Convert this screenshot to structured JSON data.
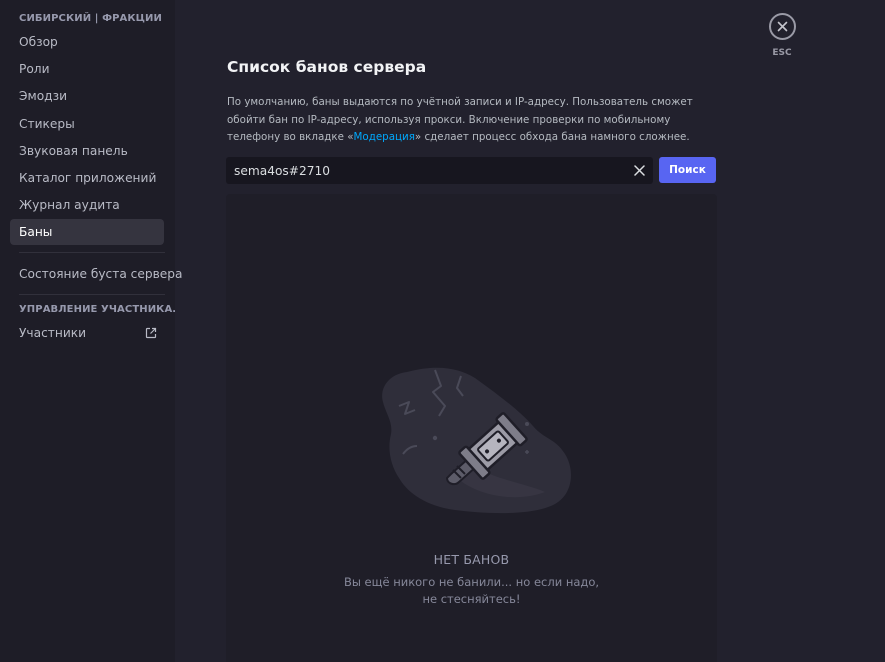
{
  "sidebar": {
    "server_header": "СИБИРСКИЙ | ФРАКЦИИ",
    "items": [
      {
        "label": "Обзор"
      },
      {
        "label": "Роли"
      },
      {
        "label": "Эмодзи"
      },
      {
        "label": "Стикеры"
      },
      {
        "label": "Звуковая панель"
      },
      {
        "label": "Каталог приложений"
      },
      {
        "label": "Журнал аудита"
      },
      {
        "label": "Баны",
        "active": true
      }
    ],
    "boost_status": "Состояние буста сервера",
    "members_header": "УПРАВЛЕНИЕ УЧАСТНИКА...",
    "members_item": "Участники",
    "members_item_icon": "external-link-icon"
  },
  "main": {
    "title": "Список банов сервера",
    "description": {
      "part1": "По умолчанию, баны выдаются по учётной записи и IP-адресу. Пользователь сможет обойти бан по IP-адресу, используя прокси. Включение проверки по мобильному телефону во вкладке «",
      "link": "Модерация",
      "part2": "» сделает процесс обхода бана намного сложнее."
    },
    "search": {
      "value": "sema4os#2710",
      "clear_icon": "close-icon",
      "button_label": "Поиск"
    },
    "empty": {
      "title": "НЕТ БАНОВ",
      "line1": "Вы ещё никого не банили... но если надо,",
      "line2": "не стесняйтесь!",
      "illustration_icon": "ban-hammer-icon"
    }
  },
  "close": {
    "icon": "close-icon",
    "label": "ESC"
  },
  "colors": {
    "background": "#22212d",
    "sidebar": "#1e1d27",
    "accent": "#5865f2",
    "link": "#00a8fc"
  }
}
